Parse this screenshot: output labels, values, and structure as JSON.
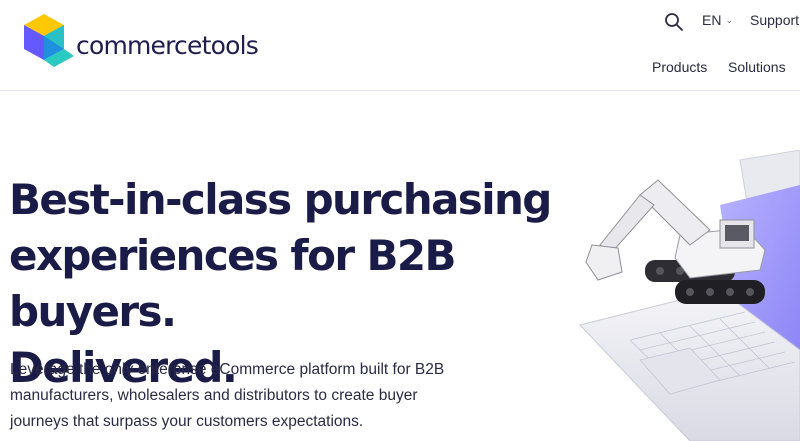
{
  "header": {
    "logo_text": "commercetools",
    "search_icon": "search-icon",
    "language": "EN",
    "support": "Support",
    "nav": {
      "products": "Products",
      "solutions": "Solutions"
    }
  },
  "hero": {
    "title_line1": "Best-in-class purchasing",
    "title_line2": "experiences for B2B buyers.",
    "title_line3": "Delivered.",
    "subtitle_line1": "Leverage the only enterprise eCommerce platform built for B2B",
    "subtitle_line2": "manufacturers, wholesalers and distributors to create buyer",
    "subtitle_line3": "journeys that surpass your customers expectations."
  },
  "colors": {
    "brand_dark": "#1f1d50",
    "logo_yellow": "#ffc805",
    "logo_purple": "#6359ff",
    "logo_teal": "#2bcac0"
  }
}
